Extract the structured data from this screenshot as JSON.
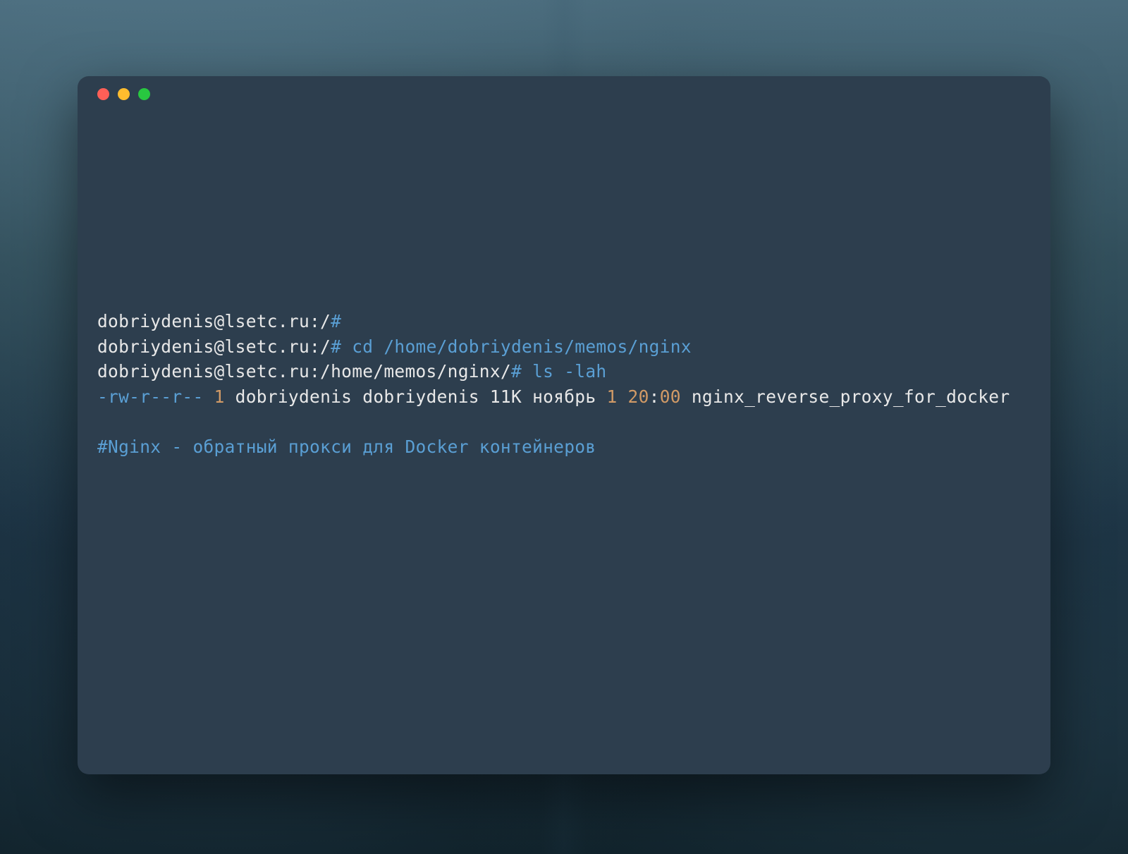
{
  "terminal": {
    "lines": [
      {
        "prompt_user": "dobriydenis@lsetc.ru:/",
        "prompt_symbol": "#"
      },
      {
        "prompt_user": "dobriydenis@lsetc.ru:/",
        "prompt_symbol": "#",
        "command": " cd /home/dobriydenis/memos/nginx"
      },
      {
        "prompt_user": "dobriydenis@lsetc.ru:/home/memos/nginx/",
        "prompt_symbol": "#",
        "command": " ls -lah"
      }
    ],
    "ls_output": {
      "permissions": "-rw-r--r--",
      "links": " 1 ",
      "owner_group": "dobriydenis dobriydenis 11K ноябрь ",
      "day": "1 ",
      "hour": "20",
      "colon": ":",
      "minute": "00 ",
      "filename": "nginx_reverse_proxy_for_docker"
    },
    "comment": "#Nginx - обратный прокси для Docker контейнеров"
  },
  "colors": {
    "close": "#ff5f57",
    "minimize": "#febc2e",
    "maximize": "#28c840",
    "terminal_bg": "#2d3e4e",
    "text_white": "#e8e8e8",
    "text_blue": "#5a9fd4",
    "text_orange": "#d19a66"
  }
}
